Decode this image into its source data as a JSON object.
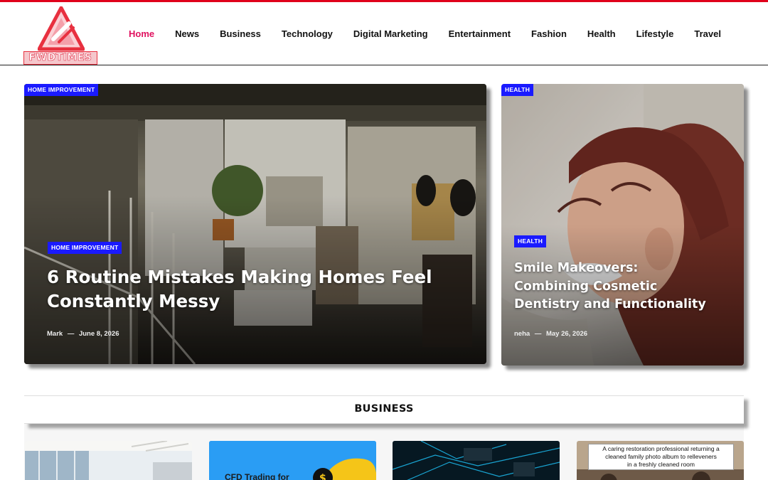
{
  "brand": {
    "logo_text": "FWDTIMES",
    "accent": "#e0001b",
    "nav_active": "#e0115f",
    "tag_color": "#1a1aff"
  },
  "nav": {
    "items": [
      {
        "label": "Home",
        "active": true
      },
      {
        "label": "News"
      },
      {
        "label": "Business"
      },
      {
        "label": "Technology"
      },
      {
        "label": "Digital Marketing"
      },
      {
        "label": "Entertainment"
      },
      {
        "label": "Fashion"
      },
      {
        "label": "Health"
      },
      {
        "label": "Lifestyle"
      },
      {
        "label": "Travel"
      }
    ]
  },
  "featured": [
    {
      "corner_tag": "HOME IMPROVEMENT",
      "tag": "HOME IMPROVEMENT",
      "title_line1": "6 Routine Mistakes Making Homes Feel",
      "title_line2": "Constantly Messy",
      "author": "Mark",
      "separator": "—",
      "date": "June 8, 2026"
    },
    {
      "corner_tag": "HEALTH",
      "tag": "HEALTH",
      "title_line1": "Smile Makeovers:",
      "title_line2": "Combining Cosmetic",
      "title_line3": "Dentistry and Functionality",
      "author": "neha",
      "separator": "—",
      "date": "May 26, 2026"
    }
  ],
  "section": {
    "title": "BUSINESS",
    "thumbs": [
      {
        "icon": "office-image"
      },
      {
        "icon": "trading-image",
        "label": "CFD Trading for"
      },
      {
        "icon": "circuit-board-image"
      },
      {
        "icon": "photo-album-image",
        "caption_line1": "A caring restoration professional returning a",
        "caption_line2": "cleaned family photo album to relleveners",
        "caption_line3": "in a freshly cleaned room"
      }
    ]
  }
}
